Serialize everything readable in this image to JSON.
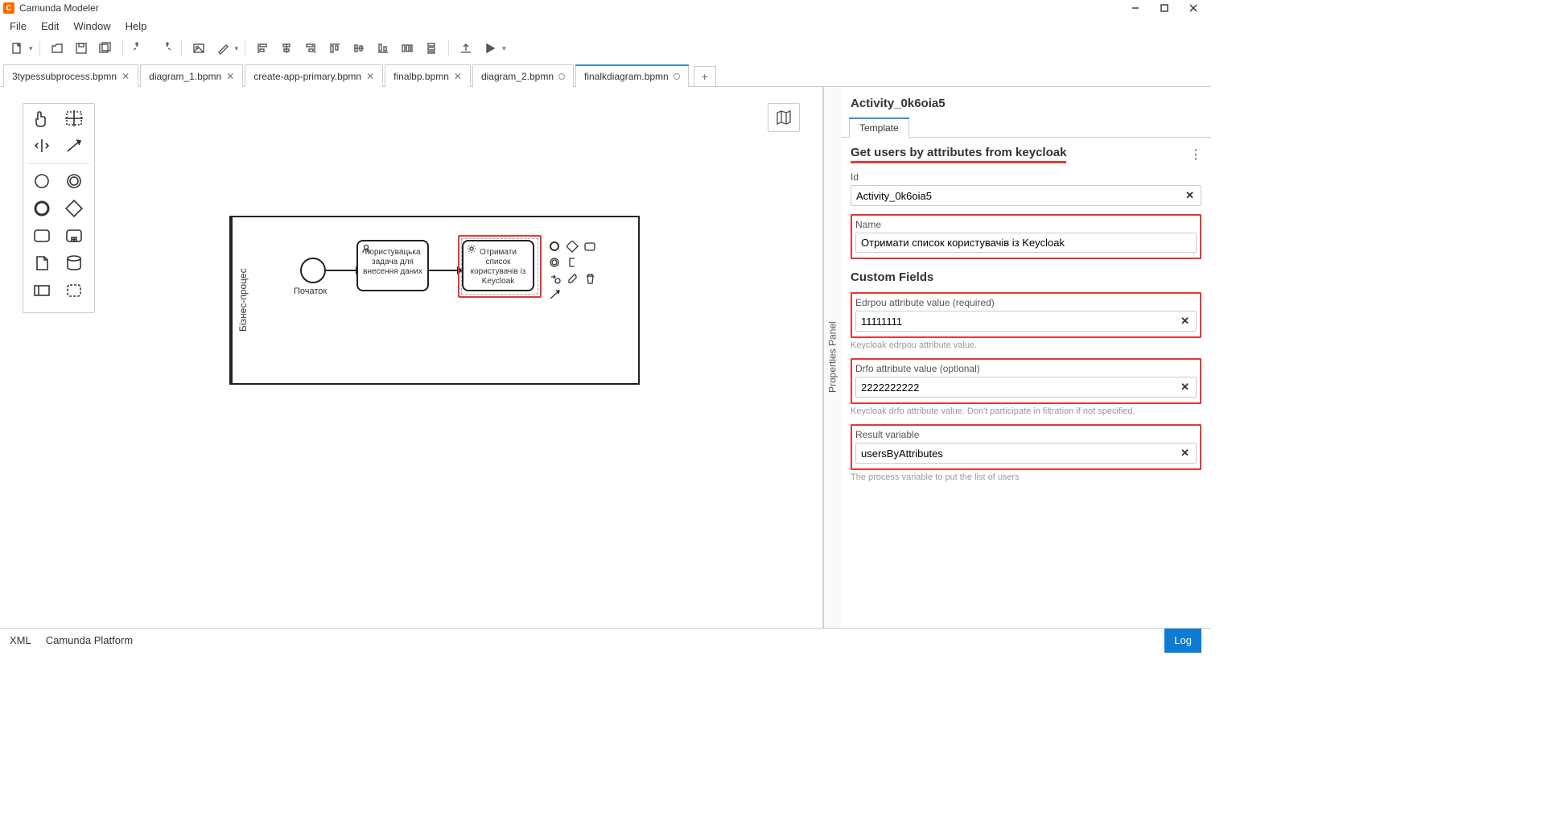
{
  "app": {
    "title": "Camunda Modeler"
  },
  "menu": {
    "file": "File",
    "edit": "Edit",
    "window": "Window",
    "help": "Help"
  },
  "tabs": {
    "items": [
      {
        "label": "3typessubprocess.bpmn",
        "dirty": false
      },
      {
        "label": "diagram_1.bpmn",
        "dirty": false
      },
      {
        "label": "create-app-primary.bpmn",
        "dirty": false
      },
      {
        "label": "finalbp.bpmn",
        "dirty": false
      },
      {
        "label": "diagram_2.bpmn",
        "dirty": true
      },
      {
        "label": "finalkdiagram.bpmn",
        "dirty": true
      }
    ],
    "activeIndex": 5
  },
  "diagram": {
    "poolLabel": "Бізнес-процес",
    "startLabel": "Початок",
    "task1": "Користувацька задача для внесення даних",
    "task2": "Отримати список користувачів із Keycloak"
  },
  "props": {
    "panelLabel": "Properties Panel",
    "elementId": "Activity_0k6oia5",
    "tab": "Template",
    "templateTitle": "Get users by attributes from keycloak",
    "idLabel": "Id",
    "idValue": "Activity_0k6oia5",
    "nameLabel": "Name",
    "nameValue": "Отримати список користувачів із Keycloak",
    "customFieldsTitle": "Custom Fields",
    "edrpouLabel": "Edrpou attribute value (required)",
    "edrpouValue": "11111111",
    "edrpouHint": "Keycloak edrpou attribute value.",
    "drfoLabel": "Drfo attribute value (optional)",
    "drfoValue": "2222222222",
    "drfoHint": "Keycloak drfo attribute value. Don't participate in filtration if not specified.",
    "resultLabel": "Result variable",
    "resultValue": "usersByAttributes",
    "resultHint": "The process variable to put the list of users"
  },
  "statusbar": {
    "xml": "XML",
    "platform": "Camunda Platform",
    "log": "Log"
  }
}
